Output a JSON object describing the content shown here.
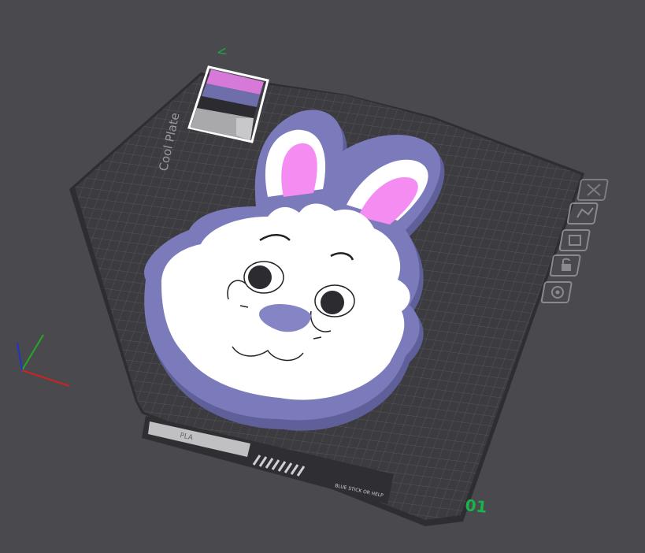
{
  "viewport": {
    "plate_name": "Cool Plate",
    "plate_number": "01",
    "wipe_tower_label": "<",
    "filament_label": "PLA",
    "plate_footer_text": "BLUE STICK OR HELP"
  },
  "plate_tools": [
    {
      "icon": "close-icon",
      "name": "delete-plate"
    },
    {
      "icon": "arrange-icon",
      "name": "auto-arrange"
    },
    {
      "icon": "orient-icon",
      "name": "auto-orient"
    },
    {
      "icon": "lock-icon",
      "name": "lock-plate"
    },
    {
      "icon": "settings-icon",
      "name": "plate-settings"
    }
  ],
  "colors": {
    "background": "#4a494e",
    "bed": "#3b3a3f",
    "bed_grid": "#57565c",
    "frame_outline": "#8a89a6",
    "frame_fill": "#7b7bba",
    "face_fill": "#ffffff",
    "ear_inner": "#f28af0",
    "nose": "#8585c6",
    "plate_number_color": "#19b34a",
    "axis_x": "#cc2222",
    "axis_y": "#22aa22",
    "axis_z": "#2233cc"
  }
}
